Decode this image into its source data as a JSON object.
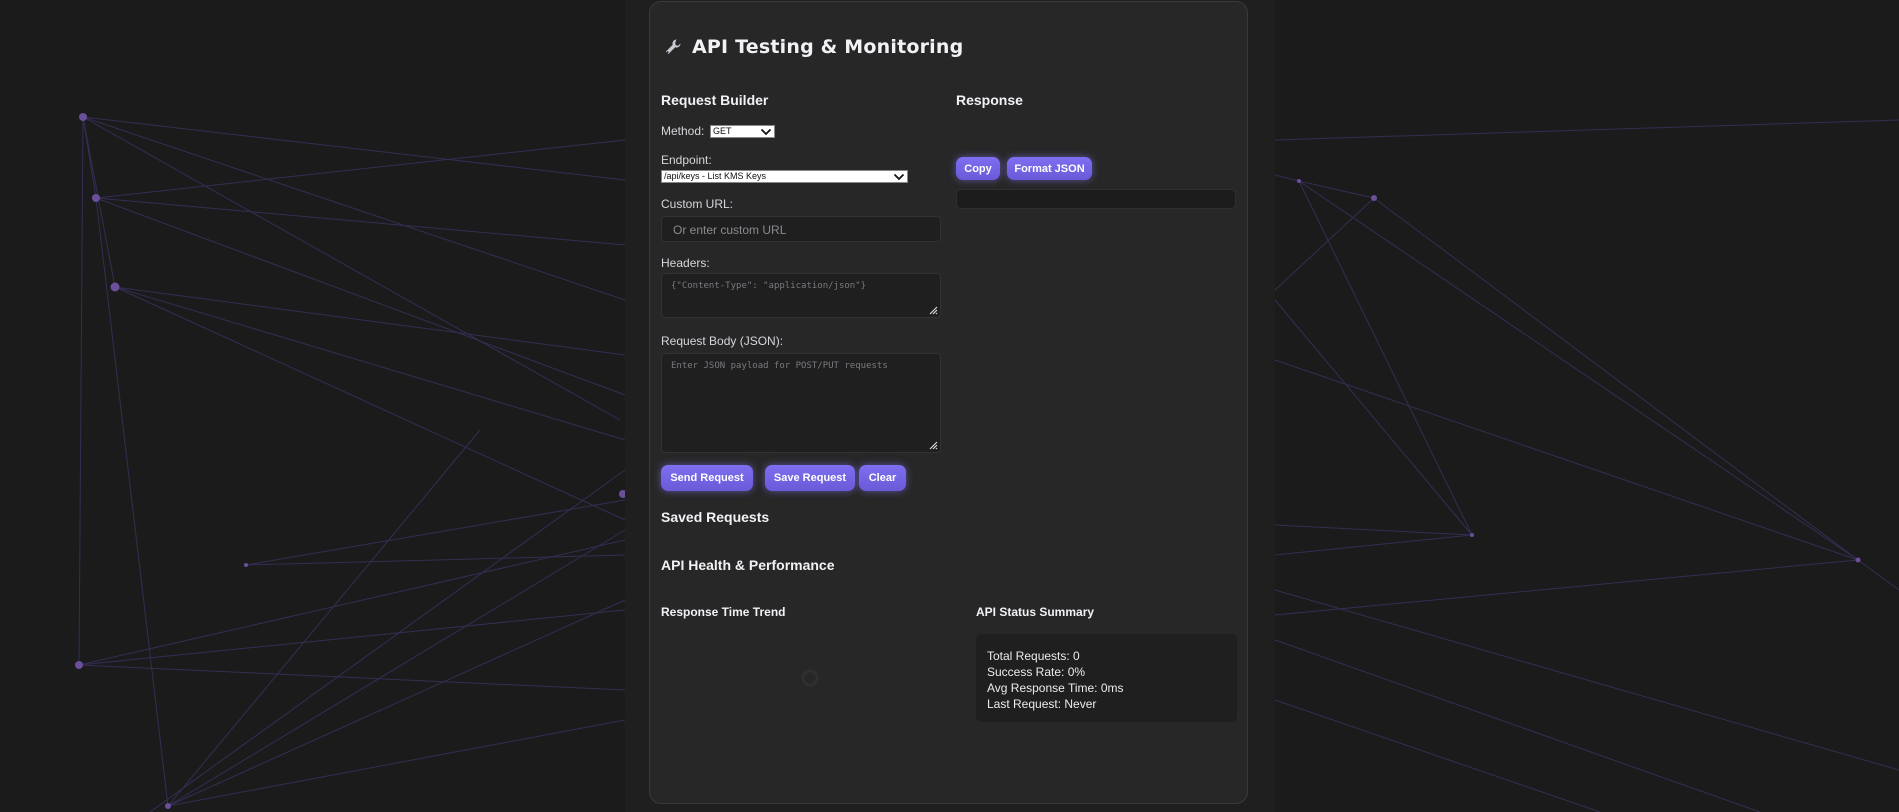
{
  "app": {
    "title": "API Testing & Monitoring",
    "title_icon": "wrench-icon"
  },
  "request_builder": {
    "heading": "Request Builder",
    "method": {
      "label": "Method:",
      "selected": "GET"
    },
    "endpoint": {
      "label": "Endpoint:",
      "selected": "/api/keys - List KMS Keys"
    },
    "custom_url": {
      "label": "Custom URL:",
      "placeholder": "Or enter custom URL"
    },
    "headers": {
      "label": "Headers:",
      "placeholder": "{\"Content-Type\": \"application/json\"}"
    },
    "body": {
      "label": "Request Body (JSON):",
      "placeholder": "Enter JSON payload for POST/PUT requests"
    },
    "buttons": {
      "send": "Send Request",
      "save": "Save Request",
      "clear": "Clear"
    }
  },
  "response": {
    "heading": "Response",
    "buttons": {
      "copy": "Copy",
      "format": "Format JSON"
    },
    "content": ""
  },
  "saved_requests": {
    "heading": "Saved Requests"
  },
  "health": {
    "heading": "API Health & Performance",
    "trend": {
      "heading": "Response Time Trend"
    },
    "summary": {
      "heading": "API Status Summary",
      "lines": [
        "Total Requests: 0",
        "Success Rate: 0%",
        "Avg Response Time: 0ms",
        "Last Request: Never"
      ]
    }
  },
  "colors": {
    "background": "#1b1b1b",
    "panel": "#272727",
    "accent": "#7466e6",
    "network_node": "#6a4f9a",
    "network_line": "#3d3466"
  }
}
